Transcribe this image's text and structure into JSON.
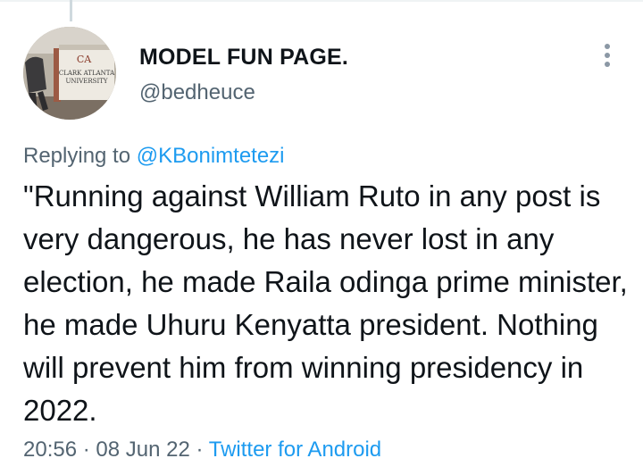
{
  "tweet": {
    "display_name": "MODEL FUN PAGE.",
    "handle": "@bedheuce",
    "avatar_sign_lines": [
      "CLARK ATLANTA",
      "UNIVERSITY"
    ],
    "replying_prefix": "Replying to",
    "replying_to": "@KBonimtetezi",
    "text": "\"Running against William Ruto in any post is very dangerous, he has never lost in any election, he made Raila odinga prime minister, he made Uhuru Kenyatta president. Nothing will prevent him from winning presidency in 2022.",
    "time": "20:56",
    "separator": "·",
    "date": "08 Jun 22",
    "source": "Twitter for Android"
  },
  "colors": {
    "text": "#0f1419",
    "secondary": "#536471",
    "link": "#1d9bf0"
  },
  "icons": {
    "more": "more-vertical-icon"
  }
}
